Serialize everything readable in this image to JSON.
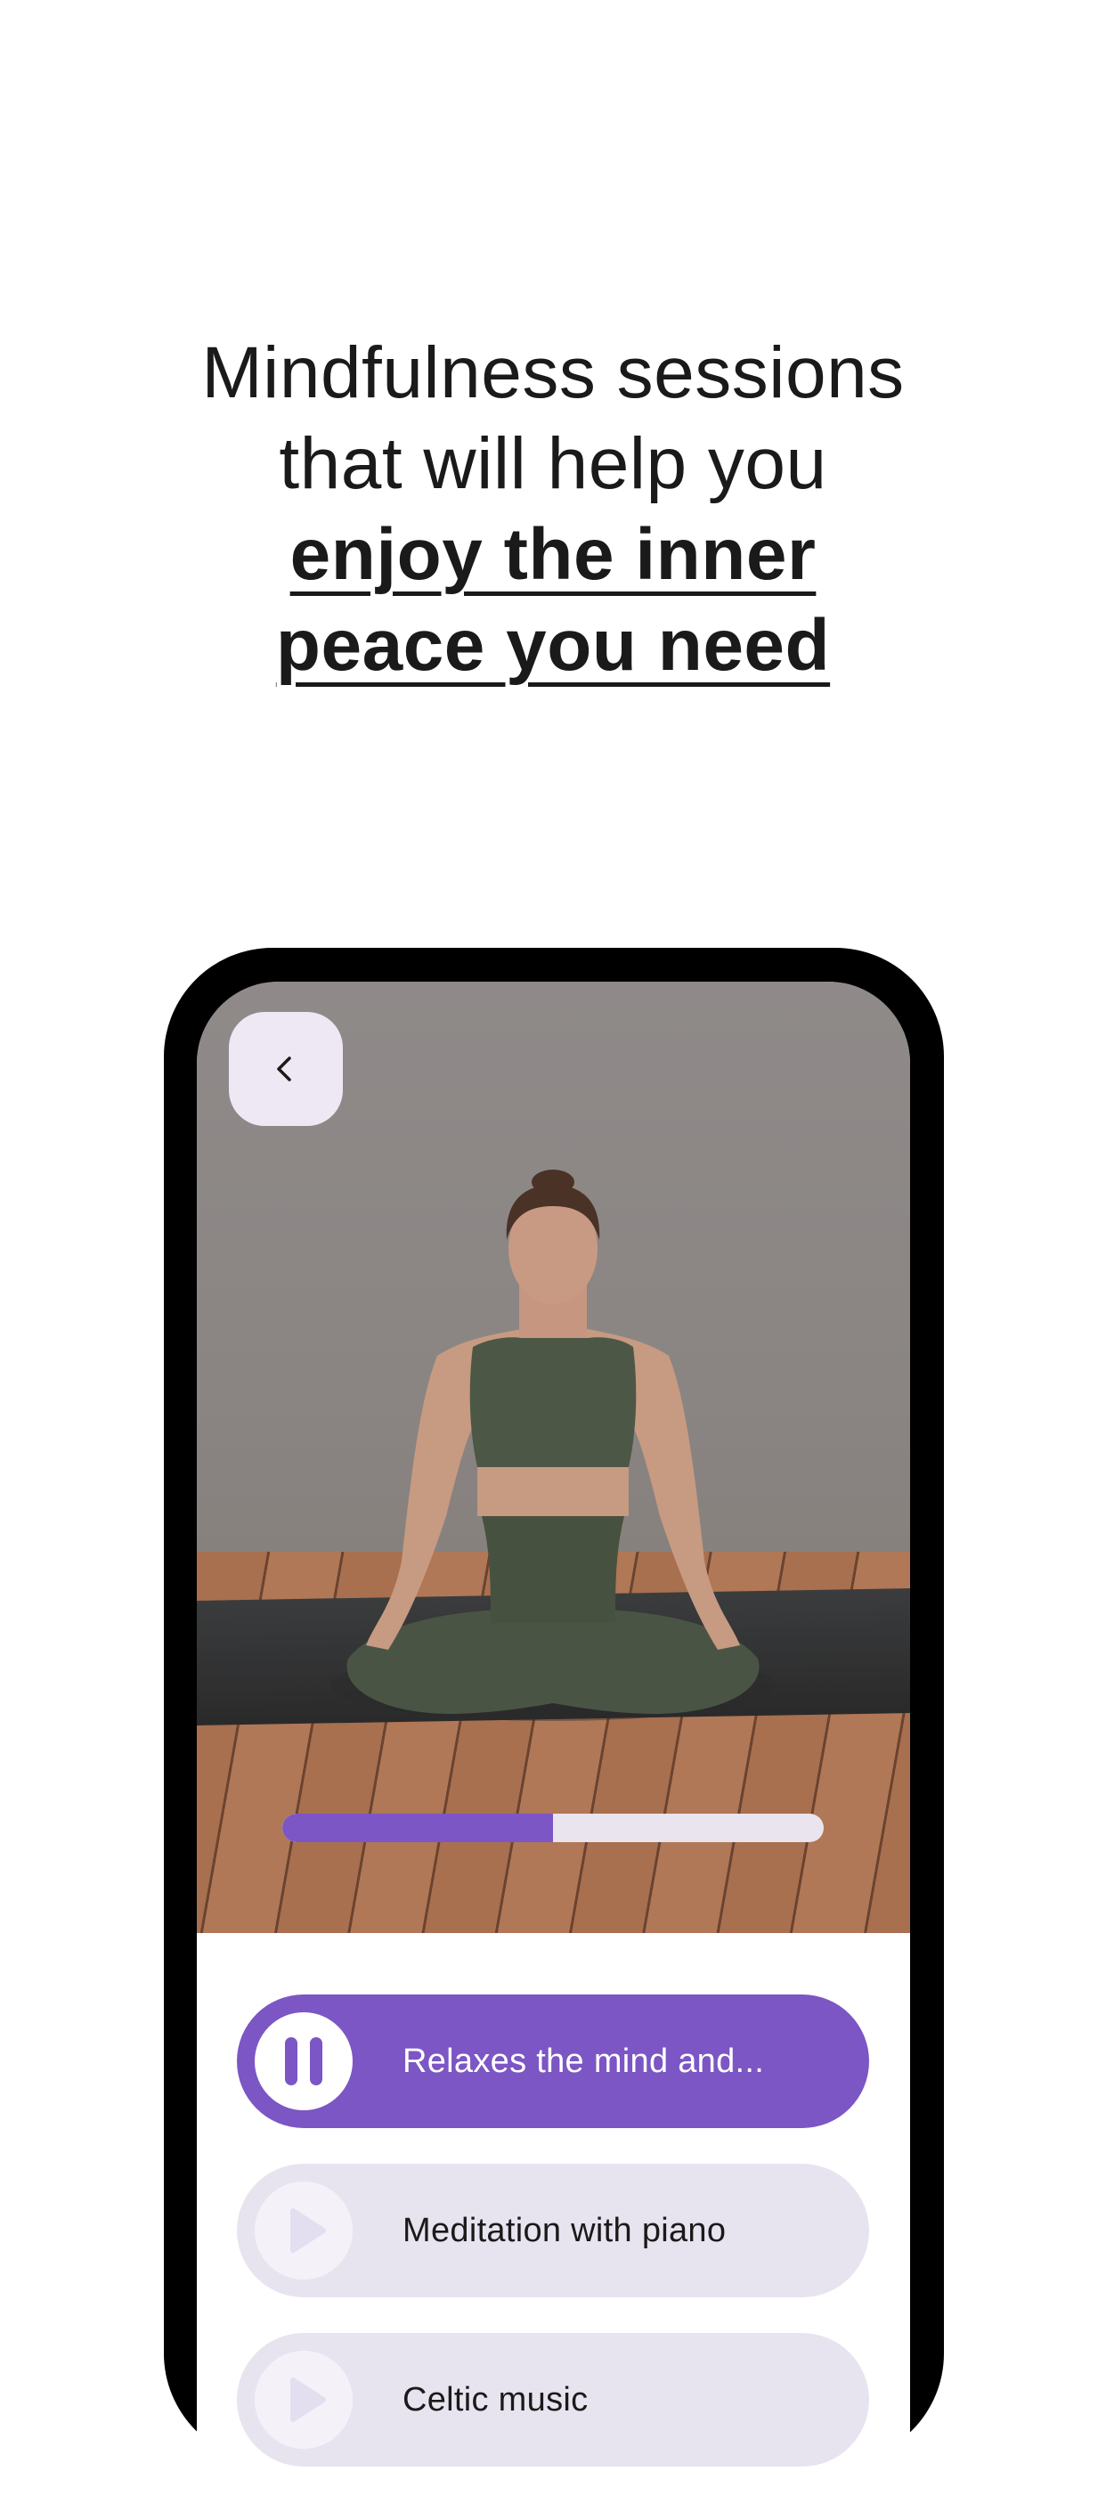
{
  "headline": {
    "line1": "Mindfulness sessions",
    "line2": "that will help you",
    "line3": "enjoy the inner",
    "line4": "peace you need"
  },
  "player": {
    "back_icon": "chevron-left-icon",
    "progress": 0.5,
    "colors": {
      "accent": "#7B56C4",
      "track_bg": "#E8E4EF"
    }
  },
  "tracks": [
    {
      "label": "Relaxes the mind and...",
      "state": "playing",
      "icon": "pause-icon"
    },
    {
      "label": "Meditation with piano",
      "state": "paused",
      "icon": "play-icon"
    },
    {
      "label": "Celtic music",
      "state": "paused",
      "icon": "play-icon"
    }
  ]
}
